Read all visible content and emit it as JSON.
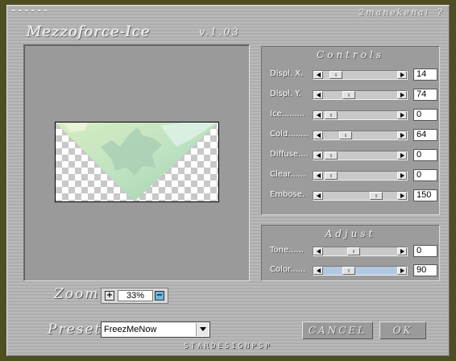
{
  "header": {
    "author": "2manekenai",
    "help": "?"
  },
  "title": "Mezzoforce-Ice",
  "version": "v.1.03",
  "controls": {
    "title": "Controls",
    "rows": [
      {
        "label": "Displ. X.",
        "value": "14"
      },
      {
        "label": "Displ. Y.",
        "value": "74"
      },
      {
        "label": "Ice.........",
        "value": "0"
      },
      {
        "label": "Cold........",
        "value": "64"
      },
      {
        "label": "Diffuse....",
        "value": "0"
      },
      {
        "label": "Clear......",
        "value": "0"
      },
      {
        "label": "Embose.",
        "value": "150"
      }
    ]
  },
  "adjust": {
    "title": "Adjust",
    "rows": [
      {
        "label": "Tone......",
        "value": "0"
      },
      {
        "label": "Color......",
        "value": "90"
      }
    ]
  },
  "zoom": {
    "label": "Zoom",
    "value": "33%"
  },
  "preset": {
    "label": "Preset",
    "value": "FreezMeNow"
  },
  "buttons": {
    "cancel": "CANCEL",
    "ok": "OK"
  },
  "footer": "STARDESIGNPSP"
}
